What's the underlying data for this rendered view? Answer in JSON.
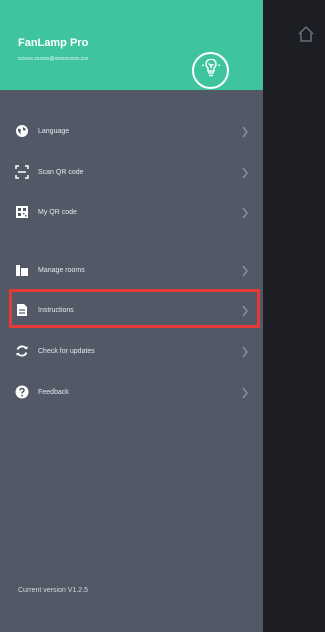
{
  "header": {
    "app_name": "FanLamp Pro",
    "account": "xxxxxx.xxxxxx@xxxxxxxxxx.xxx"
  },
  "menu": [
    {
      "label": "Language",
      "icon": "globe-icon"
    },
    {
      "label": "Scan QR code",
      "icon": "qr-scan-icon"
    },
    {
      "label": "My QR code",
      "icon": "qr-code-icon"
    },
    {
      "label": "Manage rooms",
      "icon": "rooms-icon"
    },
    {
      "label": "Instructions",
      "icon": "document-icon",
      "highlighted": true
    },
    {
      "label": "Check for updates",
      "icon": "refresh-icon"
    },
    {
      "label": "Feedback",
      "icon": "question-icon"
    }
  ],
  "footer": {
    "version": "Current version V1.2.5"
  },
  "colors": {
    "accent": "#3ec59f",
    "drawer": "#525866",
    "background": "#1c1e24",
    "highlight": "#e53935"
  }
}
